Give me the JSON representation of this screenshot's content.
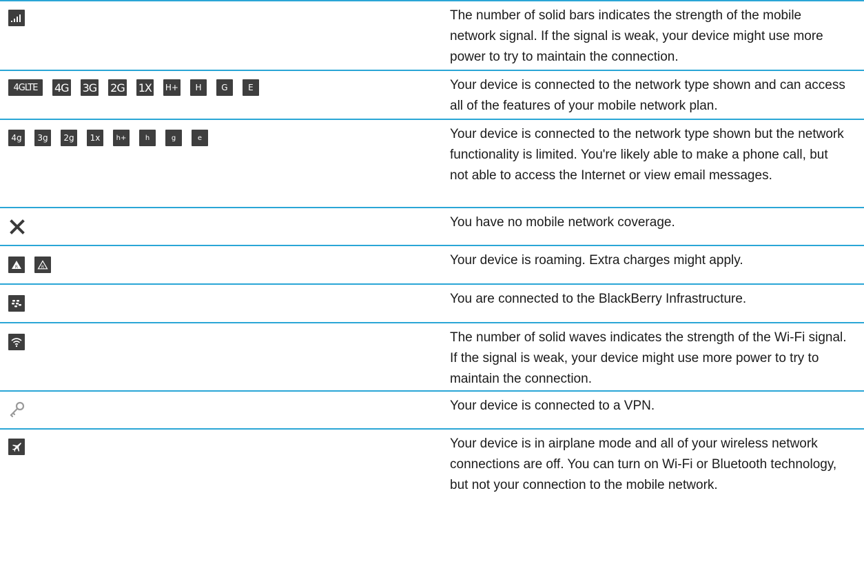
{
  "rows": [
    {
      "icons": [
        {
          "name": "signal-bars-icon"
        }
      ],
      "description": "The number of solid bars indicates the strength of the mobile network signal. If the signal is weak, your device might use more power to try to maintain the connection."
    },
    {
      "icons": [
        {
          "name": "4g-lte-icon",
          "label": "4GLTE"
        },
        {
          "name": "4g-icon",
          "label": "4G"
        },
        {
          "name": "3g-icon",
          "label": "3G"
        },
        {
          "name": "2g-icon",
          "label": "2G"
        },
        {
          "name": "1x-icon",
          "label": "1X"
        },
        {
          "name": "h-plus-icon",
          "label": "H+"
        },
        {
          "name": "h-icon",
          "label": "H"
        },
        {
          "name": "g-icon",
          "label": "G"
        },
        {
          "name": "e-icon",
          "label": "E"
        }
      ],
      "description": "Your device is connected to the network type shown and can access all of the features of your mobile network plan."
    },
    {
      "icons": [
        {
          "name": "4g-limited-icon",
          "label": "4g"
        },
        {
          "name": "3g-limited-icon",
          "label": "3g"
        },
        {
          "name": "2g-limited-icon",
          "label": "2g"
        },
        {
          "name": "1x-limited-icon",
          "label": "1x"
        },
        {
          "name": "h-plus-limited-icon",
          "label": "h+"
        },
        {
          "name": "h-limited-icon",
          "label": "h"
        },
        {
          "name": "g-limited-icon",
          "label": "g"
        },
        {
          "name": "e-limited-icon",
          "label": "e"
        }
      ],
      "description": "Your device is connected to the network type shown but the network functionality is limited. You're likely able to make a phone call, but not able to access the Internet or view email messages."
    },
    {
      "icons": [
        {
          "name": "no-coverage-x-icon"
        }
      ],
      "description": "You have no mobile network coverage."
    },
    {
      "icons": [
        {
          "name": "roaming-solid-icon"
        },
        {
          "name": "roaming-outline-icon"
        }
      ],
      "description": "Your device is roaming. Extra charges might apply."
    },
    {
      "icons": [
        {
          "name": "blackberry-logo-icon"
        }
      ],
      "description": "You are connected to the BlackBerry Infrastructure."
    },
    {
      "icons": [
        {
          "name": "wifi-signal-icon"
        }
      ],
      "description": "The number of solid waves indicates the strength of the Wi-Fi signal. If the signal is weak, your device might use more power to try to maintain the connection."
    },
    {
      "icons": [
        {
          "name": "vpn-key-icon"
        }
      ],
      "description": "Your device is connected to a VPN."
    },
    {
      "icons": [
        {
          "name": "airplane-icon"
        }
      ],
      "description": "Your device is in airplane mode and all of your wireless network connections are off. You can turn on Wi-Fi or Bluetooth technology, but not your connection to the mobile network."
    }
  ],
  "colors": {
    "rule": "#2aa6d6",
    "tile": "#3e3e3e",
    "text": "#1b1b1b"
  }
}
